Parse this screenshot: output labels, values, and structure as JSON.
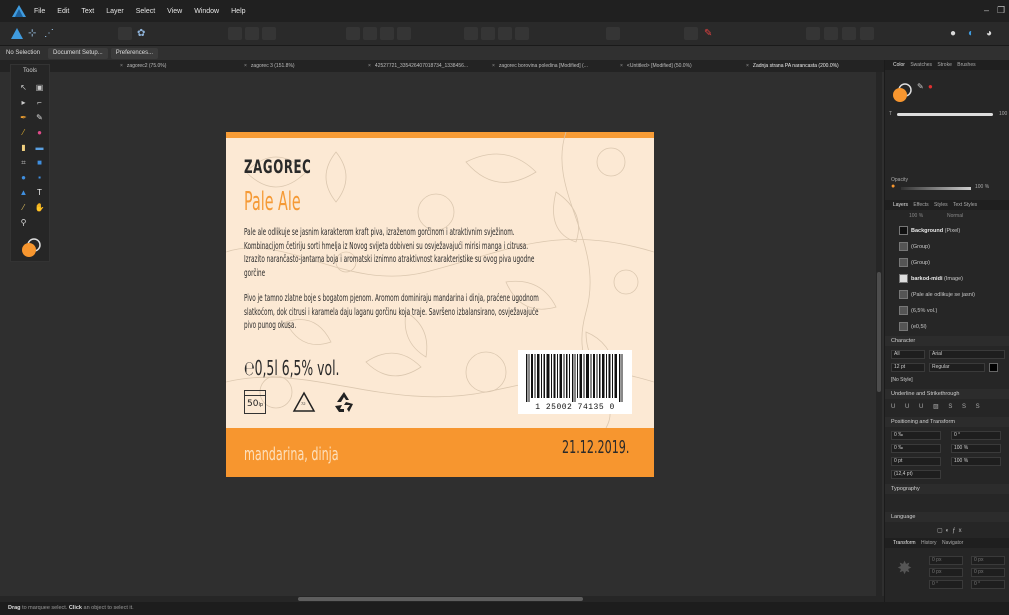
{
  "menu": [
    "File",
    "Edit",
    "Text",
    "Layer",
    "Select",
    "View",
    "Window",
    "Help"
  ],
  "context_bar": {
    "selection": "No Selection",
    "document_setup": "Document Setup...",
    "preferences": "Preferences..."
  },
  "doc_tabs": [
    "zagorec2 (75.0%)",
    "zagorec 3 (151.8%)",
    "42527721_335426407018734_1338456...",
    "zagorec borovina poledina [Modified] (...",
    "<Untitled> [Modified] (50.0%)",
    "Zadnja strana PA narancasta (200.0%)"
  ],
  "tools_panel": {
    "title": "Tools"
  },
  "label": {
    "brand": "ZAGOREC",
    "style": "Pale Ale",
    "description_1": [
      "Pale ale odlikuje se jasnim karakterom kraft piva, izraženom gorčinom i atraktivnim svježinom.",
      "Kombinacijom četiriju sorti hmelja iz Novog svijeta dobiveni su osvježavajući mirisi manga i citrusa.",
      "Izrazito narančasto-jantarna boja i aromatski iznimno atraktivnost karakteristike su ovog piva ugodne",
      "gorčine"
    ],
    "description_2": [
      "Pivo je tamno zlatne boje s bogatom pjenom. Aromom dominiraju mandarina i dinja, praćene ugodnom",
      "slatkoćom, dok citrusi i karamela daju laganu gorčinu koja traje. Savršeno izbalansirano, osvježavajuće",
      "pivo punog okusa."
    ],
    "volume": "℮0,5l   6,5% vol.",
    "deposit_value": "50",
    "deposit_unit": "lp",
    "recycle_number": "72",
    "barcode_number": "1 25002 74135 0",
    "flavor": "mandarina, dinja",
    "date": "21.12.2019."
  },
  "right_panel": {
    "color_tabs": [
      "Color",
      "Swatches",
      "Stroke",
      "Brushes"
    ],
    "opacity_label": "Opacity",
    "opacity_value": "100 %",
    "slider_value": "100",
    "layers_tabs": [
      "Layers",
      "Effects",
      "Styles",
      "Text Styles"
    ],
    "layers_opacity": "100 %",
    "blend_mode": "Normal",
    "layers": [
      {
        "name": "Background",
        "type": "(Pixel)"
      },
      {
        "name": "",
        "type": "(Group)"
      },
      {
        "name": "",
        "type": "(Group)"
      },
      {
        "name": "barkod-midi",
        "type": "(Image)"
      },
      {
        "name": "",
        "type": "(Pale ale odlikuje se jasni)"
      },
      {
        "name": "",
        "type": "(6,5% vol.)"
      },
      {
        "name": "",
        "type": "(e0,5l)"
      }
    ],
    "character": {
      "title": "Character",
      "scope": "All",
      "font": "Arial",
      "size": "12 pt",
      "weight": "Regular",
      "style": "[No Style]",
      "underline_title": "Underline and Strikethrough",
      "positioning_title": "Positioning and Transform",
      "tracking": "0 ‰",
      "kerning": "0 ‰",
      "baseline": "0 pt",
      "leading": "(12,4 pt)",
      "skew": "0 °",
      "scale_h": "100 %",
      "scale_v": "100 %",
      "typography_title": "Typography",
      "language_title": "Language"
    },
    "transform_tabs": [
      "Transform",
      "History",
      "Navigator"
    ],
    "transform_x": "0 px",
    "transform_y": "0 px",
    "transform_w": "0 px",
    "transform_h": "0 px",
    "transform_r": "0 °",
    "transform_s": "0 °"
  },
  "status": {
    "drag": "Drag",
    "drag_text": "to marquee select.",
    "click": "Click",
    "click_text": "an object to select it."
  },
  "colors": {
    "label_background": "#fce9d4",
    "label_orange": "#f7962f",
    "flavor_text": "#fde0bd",
    "app_accent": "#3f9bde"
  }
}
